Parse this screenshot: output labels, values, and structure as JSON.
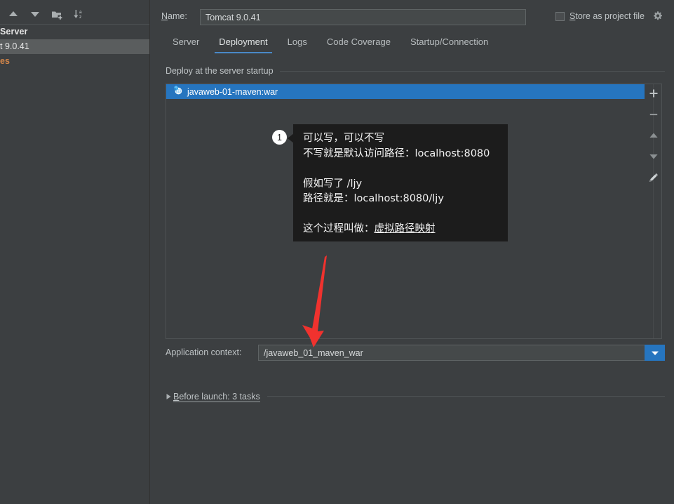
{
  "window": {
    "background_color": "#3c3f41",
    "accent_color": "#2675bf",
    "arrow_color": "#f0322e"
  },
  "sidebar": {
    "toolbar": [
      {
        "name": "move-up-icon",
        "label": "Move Up"
      },
      {
        "name": "move-down-icon",
        "label": "Move Down"
      },
      {
        "name": "new-folder-icon",
        "label": "New Folder"
      },
      {
        "name": "sort-alphabetically-icon",
        "label": "Sort Alphabetically"
      }
    ],
    "tree": [
      {
        "label": "Server",
        "state": "group",
        "truncated": true
      },
      {
        "label": "t 9.0.41",
        "state": "selected",
        "truncated": true
      },
      {
        "label": "es",
        "state": "templates",
        "truncated": true
      }
    ]
  },
  "header": {
    "name_label": "Name:",
    "name_label_mnemonic": "N",
    "name_value": "Tomcat 9.0.41",
    "name_placeholder": "",
    "store_as_project_file_label": "Store as project file",
    "store_as_project_file_mnemonic": "S",
    "store_as_project_file_checked": false,
    "gear_icon": "gear-icon"
  },
  "tabs": [
    {
      "label": "Server",
      "active": false
    },
    {
      "label": "Deployment",
      "active": true
    },
    {
      "label": "Logs",
      "active": false
    },
    {
      "label": "Code Coverage",
      "active": false
    },
    {
      "label": "Startup/Connection",
      "active": false
    }
  ],
  "deployment": {
    "section_title": "Deploy at the server startup",
    "artifacts": [
      {
        "icon": "artifact-war-icon",
        "label": "javaweb-01-maven:war",
        "selected": true
      }
    ],
    "actions": [
      {
        "name": "add-button",
        "glyph": "+",
        "label": "Add"
      },
      {
        "name": "remove-button",
        "glyph": "−",
        "label": "Remove"
      },
      {
        "name": "move-up-button",
        "glyph": "▲",
        "label": "Move Up"
      },
      {
        "name": "move-down-button",
        "glyph": "▼",
        "label": "Move Down"
      },
      {
        "name": "edit-button",
        "glyph": "pencil",
        "label": "Edit"
      }
    ],
    "app_context_label": "Application context:",
    "app_context_value": "/javaweb_01_maven_war",
    "app_context_placeholder": "",
    "dropdown_icon": "chevron-down-icon"
  },
  "before_launch": {
    "expander": "triangle-right-icon",
    "label": "Before launch: 3 tasks",
    "mnemonic": "B"
  },
  "annotation": {
    "badge": "1",
    "lines": [
      "可以写，可以不写",
      "不写就是默认访问路径：localhost:8080",
      "",
      "假如写了 /ljy",
      "路径就是：localhost:8080/ljy",
      "",
      "这个过程叫做：虚拟路径映射"
    ],
    "underlined_phrase": "虚拟路径映射",
    "text_color": "#f2f2f2",
    "background_color": "#1c1c1c",
    "arrow_note": "red arrow pointing from callout down to Application context field"
  }
}
